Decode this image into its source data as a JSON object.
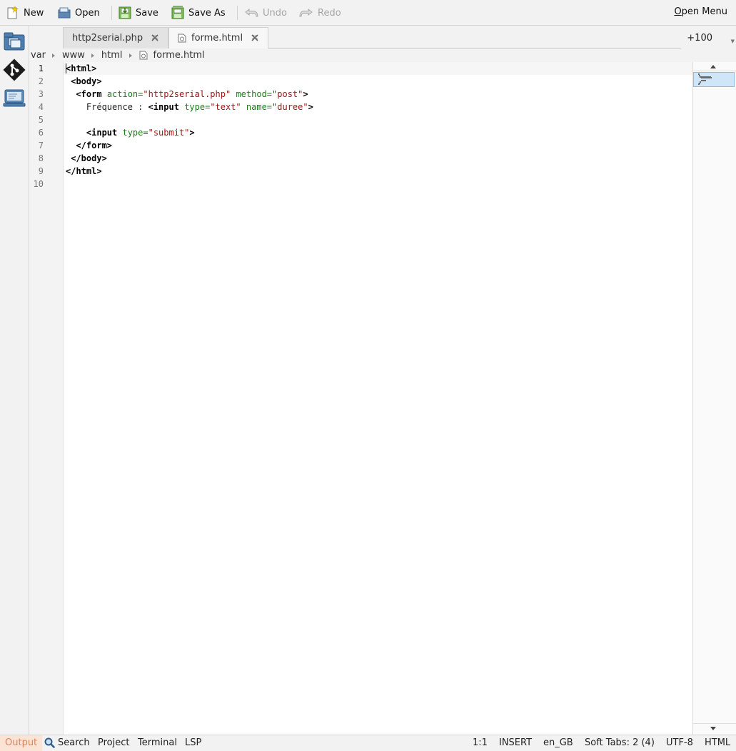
{
  "toolbar": {
    "new_label": "New",
    "open_label": "Open",
    "save_label": "Save",
    "save_as_label": "Save As",
    "undo_label": "Undo",
    "redo_label": "Redo",
    "open_menu_first": "O",
    "open_menu_rest": "pen Menu"
  },
  "left_panel": {
    "icons": [
      "file-browser-icon",
      "git-icon",
      "terminal-computer-icon"
    ]
  },
  "tabs": [
    {
      "label": "http2serial.php",
      "active": false
    },
    {
      "label": "forme.html",
      "active": true
    }
  ],
  "zoom": "+100",
  "breadcrumb": {
    "parts": [
      "var",
      "www",
      "html"
    ],
    "file": "forme.html"
  },
  "editor": {
    "current_line": 1,
    "line_numbers": [
      "1",
      "2",
      "3",
      "4",
      "5",
      "6",
      "7",
      "8",
      "9",
      "10"
    ],
    "lines": [
      {
        "indent": "",
        "tokens": [
          {
            "t": "tag",
            "s": "<html>"
          }
        ]
      },
      {
        "indent": " ",
        "tokens": [
          {
            "t": "tag",
            "s": "<body>"
          }
        ]
      },
      {
        "indent": "  ",
        "tokens": [
          {
            "t": "tag",
            "s": "<form "
          },
          {
            "t": "attr",
            "s": "action="
          },
          {
            "t": "val",
            "s": "\"http2serial.php\""
          },
          {
            "t": "txt",
            "s": " "
          },
          {
            "t": "attr",
            "s": "method="
          },
          {
            "t": "val",
            "s": "\"post\""
          },
          {
            "t": "tag",
            "s": ">"
          }
        ]
      },
      {
        "indent": "    ",
        "tokens": [
          {
            "t": "txt",
            "s": "Fréquence : "
          },
          {
            "t": "tag",
            "s": "<input "
          },
          {
            "t": "attr",
            "s": "type="
          },
          {
            "t": "val",
            "s": "\"text\""
          },
          {
            "t": "txt",
            "s": " "
          },
          {
            "t": "attr",
            "s": "name="
          },
          {
            "t": "val",
            "s": "\"duree\""
          },
          {
            "t": "tag",
            "s": ">"
          }
        ]
      },
      {
        "indent": "",
        "tokens": []
      },
      {
        "indent": "    ",
        "tokens": [
          {
            "t": "tag",
            "s": "<input "
          },
          {
            "t": "attr",
            "s": "type="
          },
          {
            "t": "val",
            "s": "\"submit\""
          },
          {
            "t": "tag",
            "s": ">"
          }
        ]
      },
      {
        "indent": "  ",
        "tokens": [
          {
            "t": "tag",
            "s": "</form>"
          }
        ]
      },
      {
        "indent": " ",
        "tokens": [
          {
            "t": "tag",
            "s": "</body>"
          }
        ]
      },
      {
        "indent": "",
        "tokens": [
          {
            "t": "tag",
            "s": "</html>"
          }
        ]
      },
      {
        "indent": "",
        "tokens": []
      }
    ]
  },
  "statusbar": {
    "output": "Output",
    "search": "Search",
    "project": "Project",
    "terminal": "Terminal",
    "lsp": "LSP",
    "position": "1:1",
    "mode": "INSERT",
    "language": "en_GB",
    "tabs": "Soft Tabs: 2 (4)",
    "encoding": "UTF-8",
    "syntax": "HTML"
  },
  "colors": {
    "tag": "#000000",
    "attribute": "#1a7f1a",
    "value": "#a31515",
    "output_badge_bg": "#fbe3d6",
    "output_badge_fg": "#d8865a",
    "minimap_view": "#cfe6f8"
  }
}
